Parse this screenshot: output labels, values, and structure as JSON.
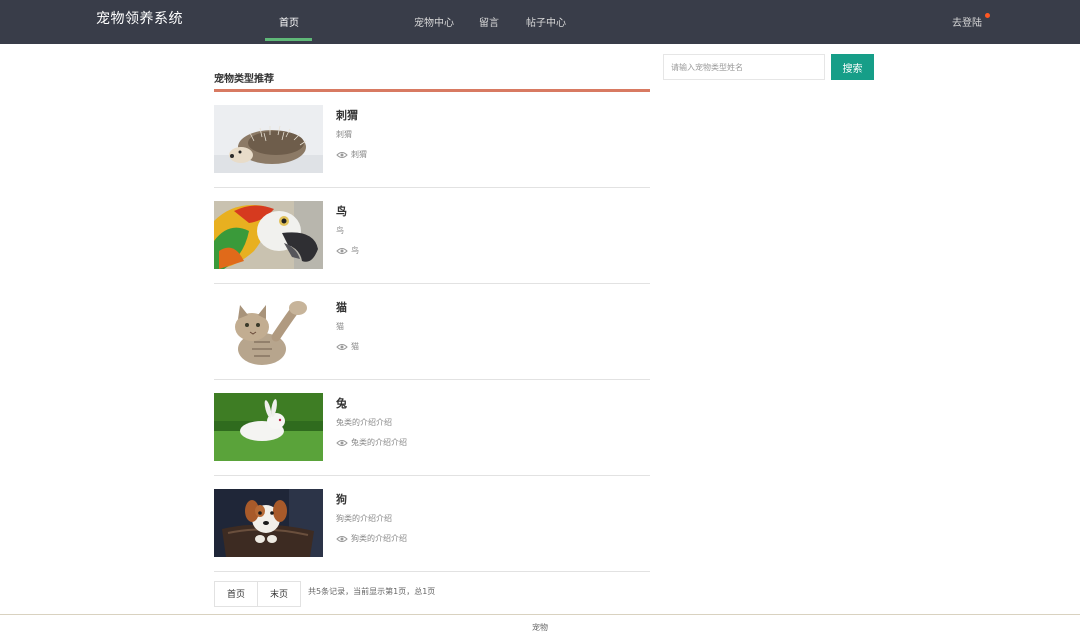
{
  "header": {
    "brand": "宠物领养系统",
    "nav": [
      {
        "label": "首页"
      },
      {
        "label": "宠物中心"
      },
      {
        "label": "留言"
      },
      {
        "label": "帖子中心"
      }
    ],
    "login_label": "去登陆"
  },
  "main": {
    "section_title": "宠物类型推荐",
    "pets": [
      {
        "name": "刺猬",
        "desc": "刺猬",
        "meta": "刺猬"
      },
      {
        "name": "鸟",
        "desc": "鸟",
        "meta": "鸟"
      },
      {
        "name": "猫",
        "desc": "猫",
        "meta": "猫"
      },
      {
        "name": "兔",
        "desc": "兔类的介绍介绍",
        "meta": "兔类的介绍介绍"
      },
      {
        "name": "狗",
        "desc": "狗类的介绍介绍",
        "meta": "狗类的介绍介绍"
      }
    ],
    "pager": {
      "first": "首页",
      "last": "末页",
      "info": "共5条记录，当前显示第1页，总1页"
    }
  },
  "sidebar": {
    "search_placeholder": "请输入宠物类型姓名",
    "search_button": "搜索"
  },
  "footer": {
    "text": "宠物"
  },
  "colors": {
    "topbar": "#393d49",
    "nav_active_underline": "#5fb878",
    "section_rule": "#d87a62",
    "search_button": "#169e88",
    "notify_dot": "#ff5722"
  }
}
